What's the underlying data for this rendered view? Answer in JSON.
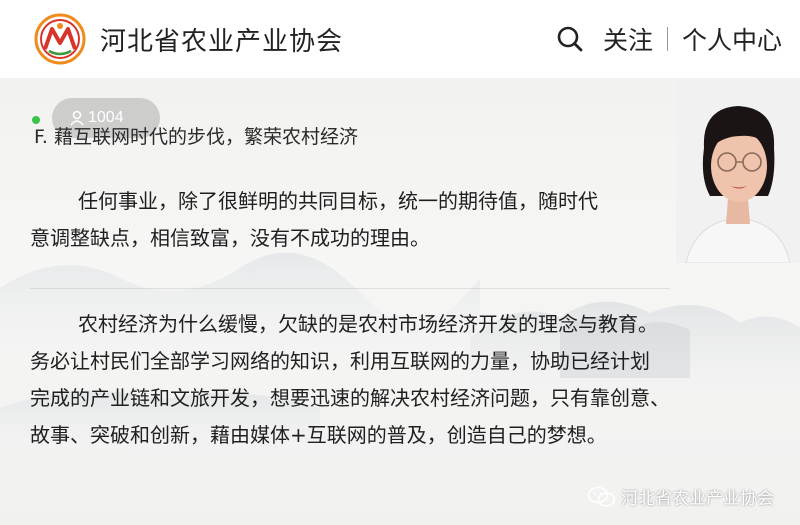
{
  "header": {
    "org_name": "河北省农业产业协会",
    "follow_label": "关注",
    "personal_label": "个人中心"
  },
  "live": {
    "viewer_count": "1004"
  },
  "slide": {
    "heading": "F.  藉互联网时代的步伐，繁荣农村经济",
    "para1": [
      "任何事业，除了很鲜明的共同目标，统一的期待值，随时代",
      "意调整缺点，相信致富，没有不成功的理由。"
    ],
    "para2": [
      "农村经济为什么缓慢，欠缺的是农村市场经济开发的理念与教育。",
      "务必让村民们全部学习网络的知识，利用互联网的力量，协助已经计划",
      "完成的产业链和文旅开发，想要迅速的解决农村经济问题，只有靠创意、",
      "故事、突破和创新，藉由媒体+互联网的普及，创造自己的梦想。"
    ]
  },
  "watermark": {
    "text": "河北省农业产业协会"
  },
  "icons": {
    "logo": "hebei-agri-association-logo",
    "search": "search-icon",
    "viewer": "person-icon",
    "wechat": "wechat-icon"
  },
  "colors": {
    "logo_red": "#d9342b",
    "logo_orange": "#f08a1c",
    "live_green": "#3cc34a"
  }
}
